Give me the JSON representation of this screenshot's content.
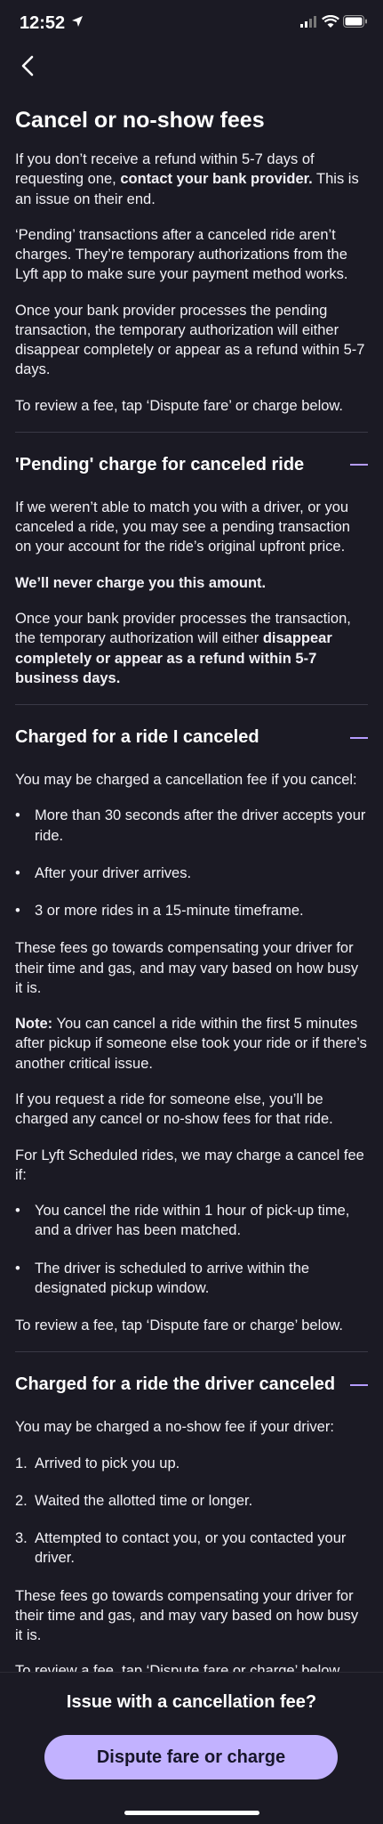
{
  "status": {
    "time": "12:52"
  },
  "header": {
    "title": "Cancel or no-show fees"
  },
  "intro": {
    "p1_a": "If you don’t receive a refund within 5-7 days of requesting one, ",
    "p1_b": "contact your bank provider.",
    "p1_c": " This is an issue on their end.",
    "p2": "‘Pending’ transactions after a canceled ride aren’t charges. They’re temporary authorizations from the Lyft app to make sure your payment method works.",
    "p3": "Once your bank provider processes the pending transaction, the temporary authorization will either disappear completely or appear as a refund within 5-7 days.",
    "p4": "To review a fee, tap ‘Dispute fare’ or charge below."
  },
  "sections": [
    {
      "title": "'Pending' charge for canceled ride",
      "p1": "If we weren’t able to match you with a driver, or you canceled a ride, you may see a pending transaction on your account for the ride’s original upfront price.",
      "p2": "We’ll never charge you this amount.",
      "p3_a": "Once your bank provider processes the transaction, the temporary authorization will either ",
      "p3_b": "disappear completely or appear as a refund within 5-7 business days."
    },
    {
      "title": "Charged for a ride I canceled",
      "p1": "You may be charged a cancellation fee if you cancel:",
      "bullets": [
        "More than 30 seconds after the driver accepts your ride.",
        "After your driver arrives.",
        "3 or more rides in a 15-minute timeframe."
      ],
      "p2": "These fees go towards compensating your driver for their time and gas, and may vary based on how busy it is.",
      "note_label": "Note:",
      "note_text": " You can cancel a ride within the first 5 minutes after pickup if someone else took your ride or if there’s another critical issue.",
      "p3": "If you request a ride for someone else, you’ll be charged any cancel or no-show fees for that ride.",
      "p4": "For Lyft Scheduled rides, we may charge a cancel fee if:",
      "bullets2": [
        "You cancel the ride within 1 hour of pick-up time, and a driver has been matched.",
        "The driver is scheduled to arrive within the designated pickup window."
      ],
      "p5": "To review a fee, tap ‘Dispute fare or charge’ below."
    },
    {
      "title": "Charged for a ride the driver canceled",
      "p1": "You may be charged a no-show fee if your driver:",
      "steps": [
        "Arrived to pick you up.",
        "Waited the allotted time or longer.",
        "Attempted to contact you, or you contacted your driver."
      ],
      "step_nums": [
        "1.",
        "2.",
        "3."
      ],
      "p2": "These fees go towards compensating your driver for their time and gas, and may vary based on how busy it is.",
      "p3": "To review a fee, tap ‘Dispute fare or charge’ below."
    }
  ],
  "footer": {
    "question": "Issue with a cancellation fee?",
    "button": "Dispute fare or charge"
  },
  "colors": {
    "background": "#1b1a24",
    "accent": "#b59cff",
    "button": "#c2b2ff"
  },
  "icons": [
    "location-arrow-icon",
    "signal-icon",
    "wifi-icon",
    "battery-icon",
    "back-chevron-icon",
    "collapse-minus-icon"
  ]
}
